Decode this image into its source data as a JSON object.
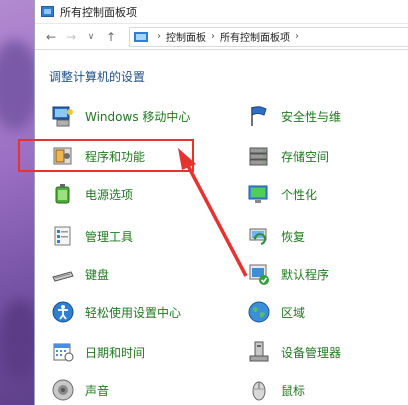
{
  "window": {
    "title": "所有控制面板项"
  },
  "address": {
    "crumbs": [
      "控制面板",
      "所有控制面板项"
    ]
  },
  "heading": "调整计算机的设置",
  "items_left": [
    {
      "label": "Windows 移动中心",
      "icon": "mobility-center-icon"
    },
    {
      "label": "程序和功能",
      "icon": "programs-features-icon"
    },
    {
      "label": "电源选项",
      "icon": "power-options-icon"
    },
    {
      "label": "管理工具",
      "icon": "admin-tools-icon"
    },
    {
      "label": "键盘",
      "icon": "keyboard-icon"
    },
    {
      "label": "轻松使用设置中心",
      "icon": "ease-of-access-icon"
    },
    {
      "label": "日期和时间",
      "icon": "date-time-icon"
    },
    {
      "label": "声音",
      "icon": "sound-icon"
    }
  ],
  "items_right": [
    {
      "label": "安全性与维",
      "icon": "security-flag-icon"
    },
    {
      "label": "存储空间",
      "icon": "storage-spaces-icon"
    },
    {
      "label": "个性化",
      "icon": "personalization-icon"
    },
    {
      "label": "恢复",
      "icon": "recovery-icon"
    },
    {
      "label": "默认程序",
      "icon": "default-programs-icon"
    },
    {
      "label": "区域",
      "icon": "region-icon"
    },
    {
      "label": "设备管理器",
      "icon": "device-manager-icon"
    },
    {
      "label": "鼠标",
      "icon": "mouse-icon"
    }
  ],
  "colors": {
    "link": "#1e7a1e",
    "heading": "#1e4e8c",
    "highlight": "#e8322f"
  }
}
